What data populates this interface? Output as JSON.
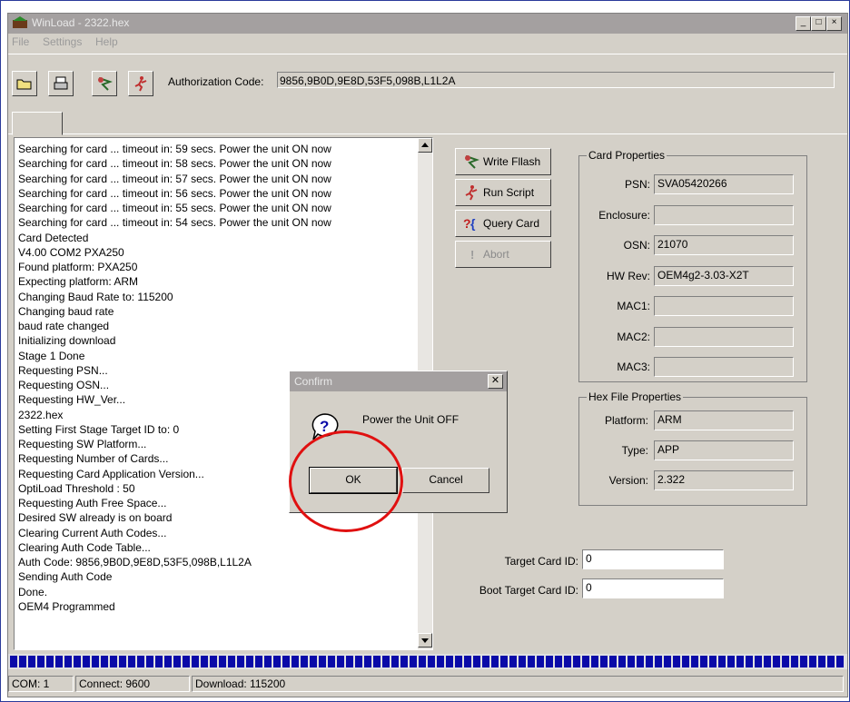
{
  "window": {
    "title": "WinLoad - 2322.hex",
    "controls": [
      "_",
      "□",
      "×"
    ]
  },
  "menu": [
    "File",
    "Settings",
    "Help"
  ],
  "toolbar": {
    "buttons": [
      "open-icon",
      "print-icon",
      "flash-icon",
      "script-icon"
    ],
    "auth_label": "Authorization Code:",
    "auth_value": "9856,9B0D,9E8D,53F5,098B,L1L2A"
  },
  "log": [
    "Searching for card ... timeout in: 59 secs.  Power the unit ON now",
    "Searching for card ... timeout in: 58 secs.  Power the unit ON now",
    "Searching for card ... timeout in: 57 secs.  Power the unit ON now",
    "Searching for card ... timeout in: 56 secs.  Power the unit ON now",
    "Searching for card ... timeout in: 55 secs.  Power the unit ON now",
    "Searching for card ... timeout in: 54 secs.  Power the unit ON now",
    "Card Detected",
    "V4.00 COM2 PXA250",
    "Found platform: PXA250",
    "Expecting platform: ARM",
    "Changing Baud Rate to: 115200",
    "Changing baud rate",
    "baud rate changed",
    "Initializing download",
    "Stage 1 Done",
    "Requesting PSN...",
    "Requesting OSN...",
    "Requesting HW_Ver...",
    "2322.hex",
    "Setting First Stage Target ID to: 0",
    "Requesting SW Platform...",
    "Requesting Number of Cards...",
    "Requesting Card Application Version...",
    "OptiLoad Threshold : 50",
    "Requesting Auth Free Space...",
    "Desired SW already is on board",
    "Clearing Current Auth Codes...",
    "Clearing Auth Code Table...",
    "Auth Code: 9856,9B0D,9E8D,53F5,098B,L1L2A",
    "Sending Auth Code",
    "Done.",
    "OEM4 Programmed"
  ],
  "actions": {
    "write_flash": "Write Fllash",
    "run_script": "Run Script",
    "query_card": "Query Card",
    "abort": "Abort"
  },
  "card_properties": {
    "title": "Card Properties",
    "fields": [
      {
        "label": "PSN:",
        "value": "SVA05420266"
      },
      {
        "label": "Enclosure:",
        "value": ""
      },
      {
        "label": "OSN:",
        "value": "21070"
      },
      {
        "label": "HW Rev:",
        "value": "OEM4g2-3.03-X2T"
      },
      {
        "label": "MAC1:",
        "value": ""
      },
      {
        "label": "MAC2:",
        "value": ""
      },
      {
        "label": "MAC3:",
        "value": ""
      }
    ]
  },
  "hex_properties": {
    "title": "Hex File Properties",
    "fields": [
      {
        "label": "Platform:",
        "value": "ARM"
      },
      {
        "label": "Type:",
        "value": "APP"
      },
      {
        "label": "Version:",
        "value": "2.322"
      }
    ]
  },
  "target": {
    "target_label": "Target Card ID:",
    "target_value": "0",
    "boot_label": "Boot Target Card ID:",
    "boot_value": "0"
  },
  "progress": {
    "fraction": 1.0,
    "color": "#0a0aa8"
  },
  "status": {
    "com": "COM: 1",
    "connect": "Connect: 9600",
    "download": "Download: 115200"
  },
  "dialog": {
    "title": "Confirm",
    "message": "Power the Unit OFF",
    "ok": "OK",
    "cancel": "Cancel",
    "icon": "question-icon"
  },
  "annotation_color": "#e01010"
}
